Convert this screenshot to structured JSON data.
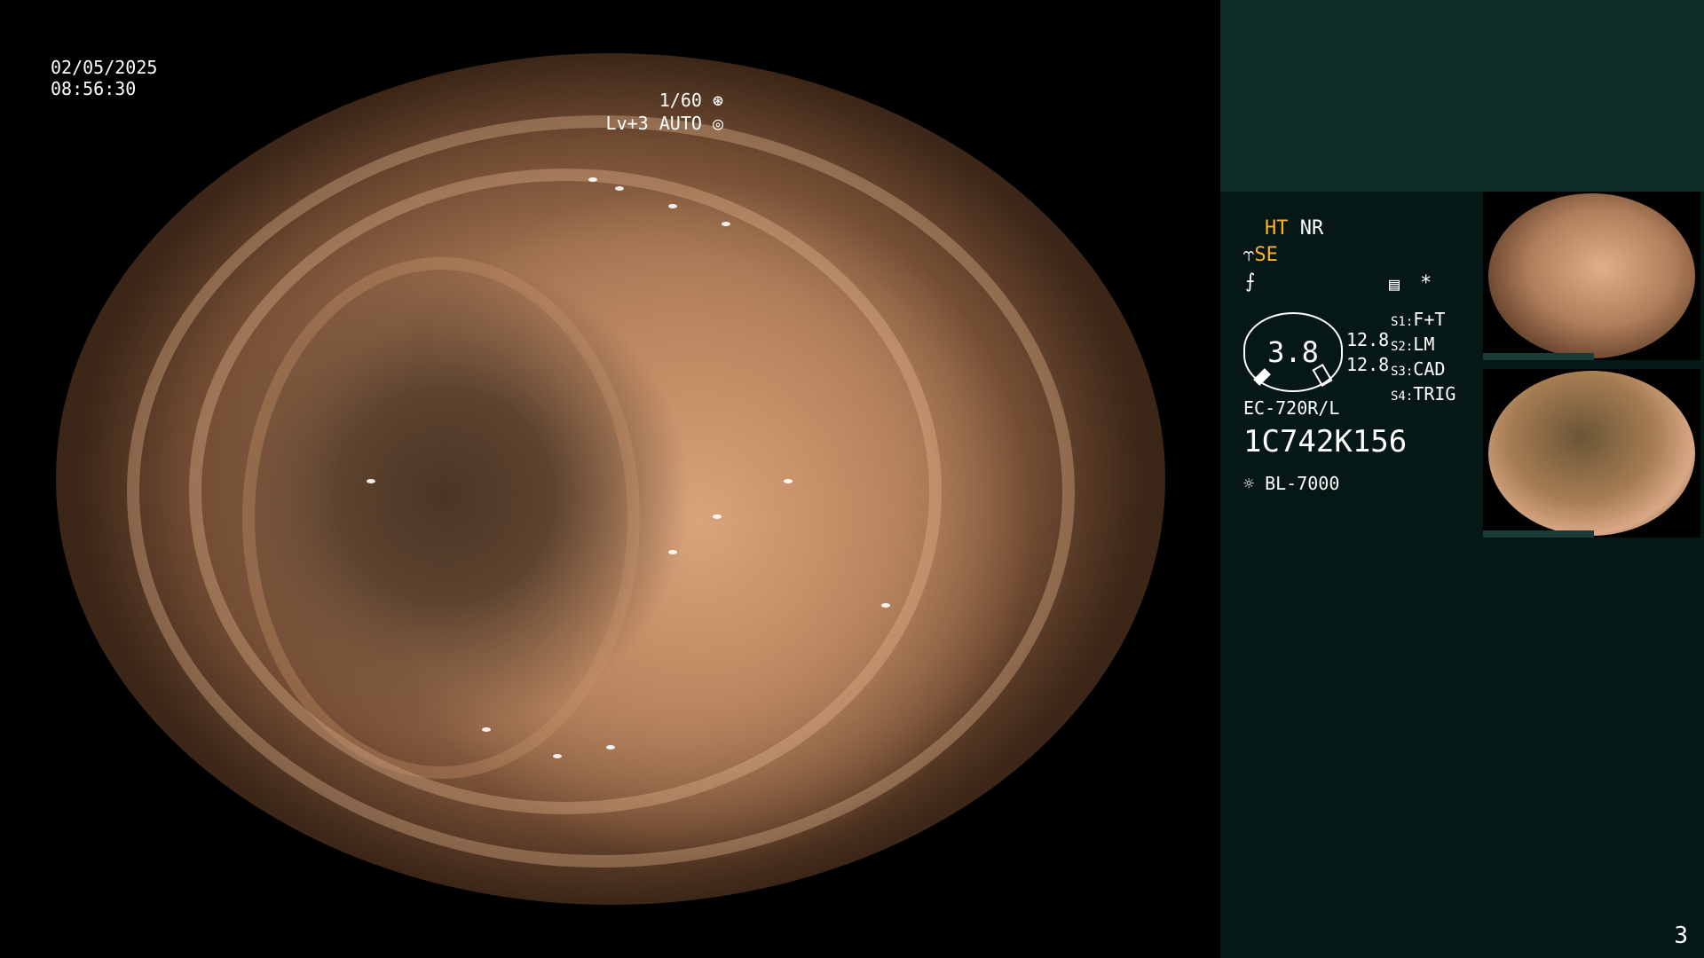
{
  "overlay": {
    "date": "02/05/2025",
    "time": "08:56:30",
    "shutter": "1/60",
    "level_mode": "Lv+3 AUTO"
  },
  "panel": {
    "ht": "HT",
    "nr": "NR",
    "se": "SE",
    "gauge_value": "3.8",
    "readout_1": "12.8",
    "readout_2": "12.8",
    "switches": [
      {
        "key": "S1:",
        "value": "F+T"
      },
      {
        "key": "S2:",
        "value": "LM"
      },
      {
        "key": "S3:",
        "value": "CAD"
      },
      {
        "key": "S4:",
        "value": "TRIG"
      }
    ],
    "asterisk": "*",
    "scope_model": "EC-720R/L",
    "serial": "1C742K156",
    "light_source": "BL-7000",
    "page_number": "3"
  },
  "colors": {
    "panel_bg": "#061816",
    "panel_header": "#0f2e2a",
    "accent_orange": "#ffb12a"
  },
  "icons": [
    "shutter-icon",
    "auto-iris-icon",
    "structure-enhance-icon",
    "freeze-icon",
    "memo-icon",
    "light-bulb-icon"
  ]
}
